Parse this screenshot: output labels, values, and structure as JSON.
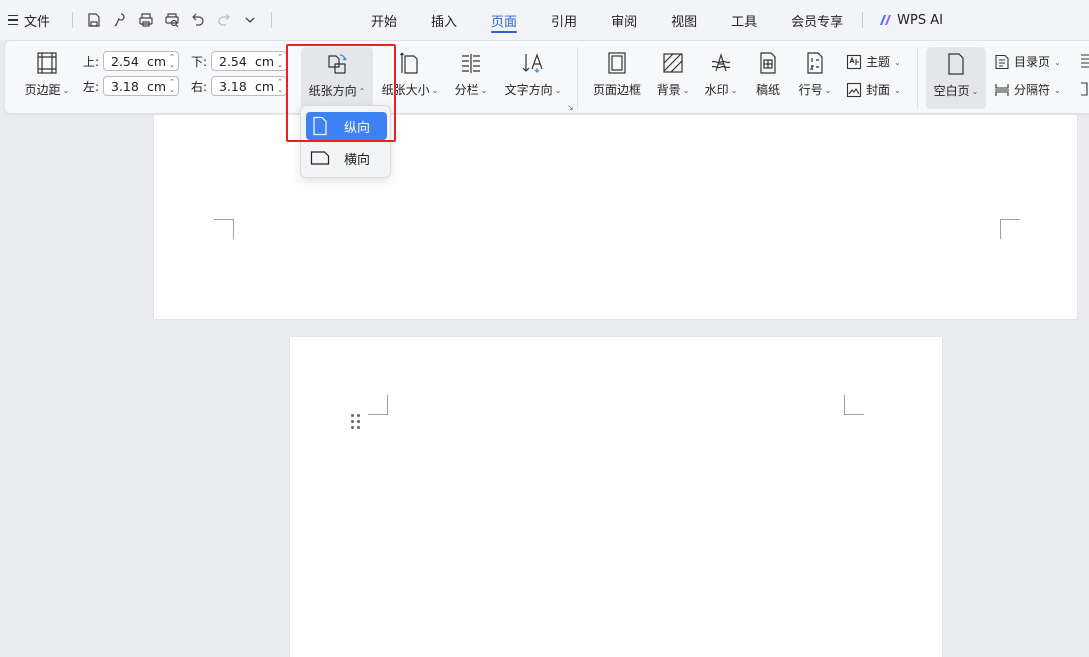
{
  "menubar": {
    "file_label": "文件",
    "tabs": [
      {
        "label": "开始",
        "active": false
      },
      {
        "label": "插入",
        "active": false
      },
      {
        "label": "页面",
        "active": true
      },
      {
        "label": "引用",
        "active": false
      },
      {
        "label": "审阅",
        "active": false
      },
      {
        "label": "视图",
        "active": false
      },
      {
        "label": "工具",
        "active": false
      },
      {
        "label": "会员专享",
        "active": false
      }
    ],
    "ai_label": "WPS AI",
    "accent_color": "#2b5fd9"
  },
  "ribbon": {
    "margins_label": "页边距",
    "margins": {
      "top_label": "上:",
      "top_value": "2.54",
      "bottom_label": "下:",
      "bottom_value": "2.54",
      "left_label": "左:",
      "left_value": "3.18",
      "right_label": "右:",
      "right_value": "3.18",
      "unit": "cm"
    },
    "orientation_label": "纸张方向",
    "size_label": "纸张大小",
    "columns_label": "分栏",
    "text_direction_label": "文字方向",
    "page_border_label": "页面边框",
    "background_label": "背景",
    "watermark_label": "水印",
    "manuscript_label": "稿纸",
    "line_number_label": "行号",
    "theme_label": "主题",
    "cover_label": "封面",
    "blank_page_label": "空白页",
    "toc_page_label": "目录页",
    "separator_label": "分隔符"
  },
  "orientation_menu": {
    "items": [
      {
        "label": "纵向",
        "selected": true
      },
      {
        "label": "横向",
        "selected": false
      }
    ],
    "selected_color": "#3d82f4",
    "highlight_color": "#e8231f"
  }
}
